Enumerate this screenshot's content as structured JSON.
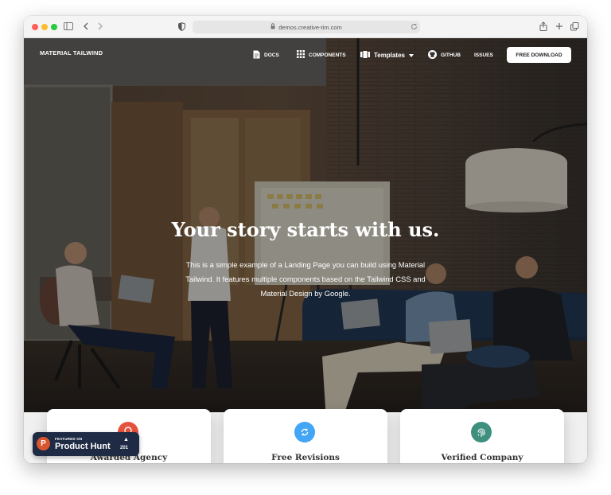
{
  "browser": {
    "url": "demos.creative-tim.com",
    "icons": [
      "sidebar-toggle-icon",
      "back-icon",
      "forward-icon",
      "privacy-shield-icon",
      "lock-icon",
      "reload-icon",
      "share-icon",
      "new-tab-icon",
      "tab-overview-icon"
    ]
  },
  "nav": {
    "brand": "MATERIAL TAILWIND",
    "docs": "DOCS",
    "components": "COMPONENTS",
    "templates": "Templates",
    "github": "GITHUB",
    "issues": "ISSUES",
    "download": "FREE DOWNLOAD"
  },
  "hero": {
    "title": "Your story starts with us.",
    "subtitle": "This is a simple example of a Landing Page you can build using Material Tailwind. It features multiple components based on the Tailwind CSS and Material Design by Google."
  },
  "cards": [
    {
      "title": "Awarded Agency",
      "color": "#e5533d",
      "icon": "award-icon"
    },
    {
      "title": "Free Revisions",
      "color": "#42a5f5",
      "icon": "refresh-icon"
    },
    {
      "title": "Verified Company",
      "color": "#3f8f7f",
      "icon": "fingerprint-icon"
    }
  ],
  "product_hunt": {
    "logo": "P",
    "featured": "FEATURED ON",
    "name": "Product Hunt",
    "upvotes": "201"
  },
  "colors": {
    "light_red": "#ff5f57",
    "light_yellow": "#febc2e",
    "light_green": "#28c840"
  }
}
